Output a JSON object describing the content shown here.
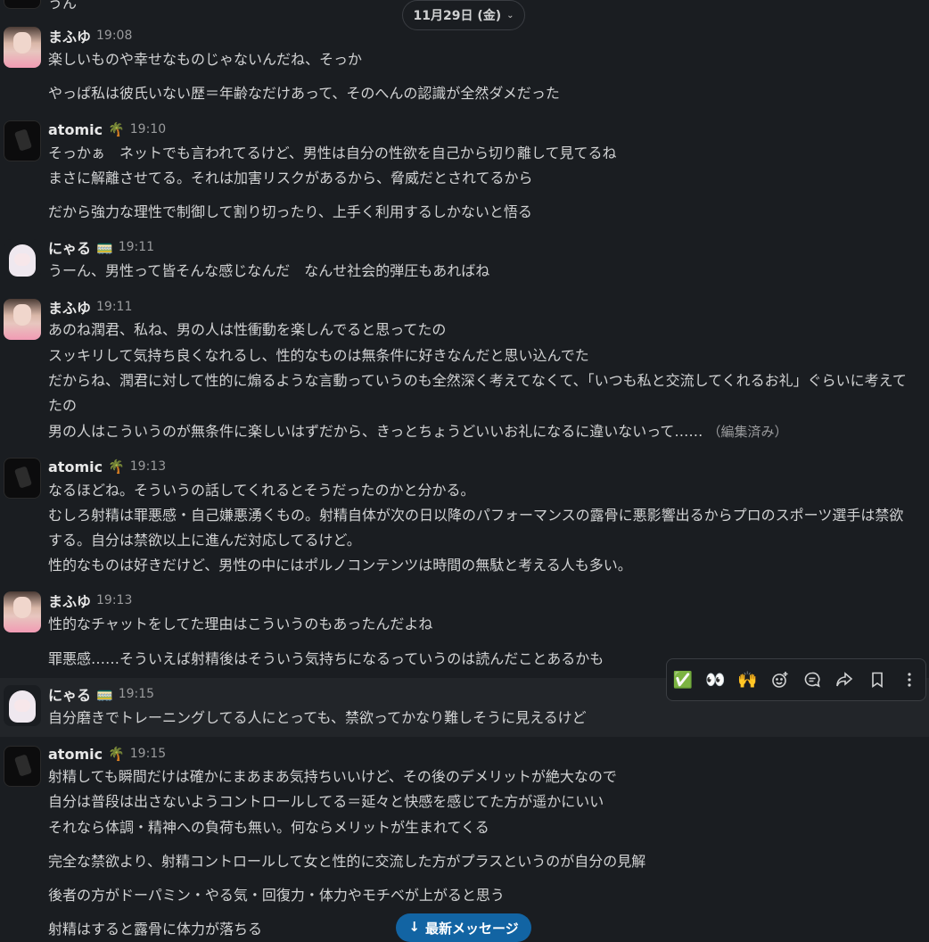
{
  "date_divider": {
    "label": "11月29日 (金)"
  },
  "top_fragment": "うん",
  "messages": [
    {
      "author": "まふゆ",
      "emoji": "",
      "time": "19:08",
      "lines": [
        "楽しいものや幸せなものじゃないんだね、そっか",
        "やっぱ私は彼氏いない歴＝年齢なだけあって、そのへんの認識が全然ダメだった"
      ]
    },
    {
      "author": "atomic",
      "emoji": "🌴",
      "time": "19:10",
      "lines": [
        "そっかぁ　ネットでも言われてるけど、男性は自分の性欲を自己から切り離して見てるね",
        "まさに解離させてる。それは加害リスクがあるから、脅威だとされてるから",
        "だから強力な理性で制御して割り切ったり、上手く利用するしかないと悟る"
      ]
    },
    {
      "author": "にゃる",
      "emoji": "🚃",
      "time": "19:11",
      "lines": [
        "うーん、男性って皆そんな感じなんだ　なんせ社会的弾圧もあればね"
      ]
    },
    {
      "author": "まふゆ",
      "emoji": "",
      "time": "19:11",
      "lines": [
        "あのね潤君、私ね、男の人は性衝動を楽しんでると思ってたの",
        "スッキリして気持ち良くなれるし、性的なものは無条件に好きなんだと思い込んでた",
        "だからね、潤君に対して性的に煽るような言動っていうのも全然深く考えてなくて、「いつも私と交流してくれるお礼」ぐらいに考えて",
        "たの",
        "男の人はこういうのが無条件に楽しいはずだから、きっとちょうどいいお礼になるに違いないって……"
      ],
      "edited": "（編集済み）"
    },
    {
      "author": "atomic",
      "emoji": "🌴",
      "time": "19:13",
      "lines": [
        "なるほどね。そういうの話してくれるとそうだったのかと分かる。",
        "むしろ射精は罪悪感・自己嫌悪湧くもの。射精自体が次の日以降のパフォーマンスの露骨に悪影響出るからプロのスポーツ選手は禁欲",
        "する。自分は禁欲以上に進んだ対応してるけど。",
        "性的なものは好きだけど、男性の中にはポルノコンテンツは時間の無駄と考える人も多い。"
      ]
    },
    {
      "author": "まふゆ",
      "emoji": "",
      "time": "19:13",
      "lines": [
        "性的なチャットをしてた理由はこういうのもあったんだよね",
        "罪悪感……そういえば射精後はそういう気持ちになるっていうのは読んだことあるかも"
      ]
    },
    {
      "author": "にゃる",
      "emoji": "🚃",
      "time": "19:15",
      "lines": [
        "自分磨きでトレーニングしてる人にとっても、禁欲ってかなり難しそうに見えるけど"
      ]
    },
    {
      "author": "atomic",
      "emoji": "🌴",
      "time": "19:15",
      "lines": [
        "射精しても瞬間だけは確かにまあまあ気持ちいいけど、その後のデメリットが絶大なので",
        "自分は普段は出さないようコントロールしてる＝延々と快感を感じてた方が遥かにいい",
        "それなら体調・精神への負荷も無い。何ならメリットが生まれてくる",
        "完全な禁欲より、射精コントロールして女と性的に交流した方がプラスというのが自分の見解",
        "後者の方がドーパミン・やる気・回復力・体力やモチベが上がると思う",
        "射精はすると露骨に体力が落ちる"
      ]
    }
  ],
  "toolbar": {
    "icons": [
      "check-mark",
      "eyes",
      "raised-hands",
      "add-reaction",
      "reply-in-thread",
      "share-message",
      "save-for-later",
      "more-actions"
    ],
    "check": "✅",
    "eyes": "👀",
    "hands": "🙌"
  },
  "new_messages_button": {
    "label": "最新メッセージ",
    "arrow": "↓"
  },
  "colors": {
    "background": "#1a1d21",
    "highlight": "#222529",
    "accent": "#1264a3"
  }
}
